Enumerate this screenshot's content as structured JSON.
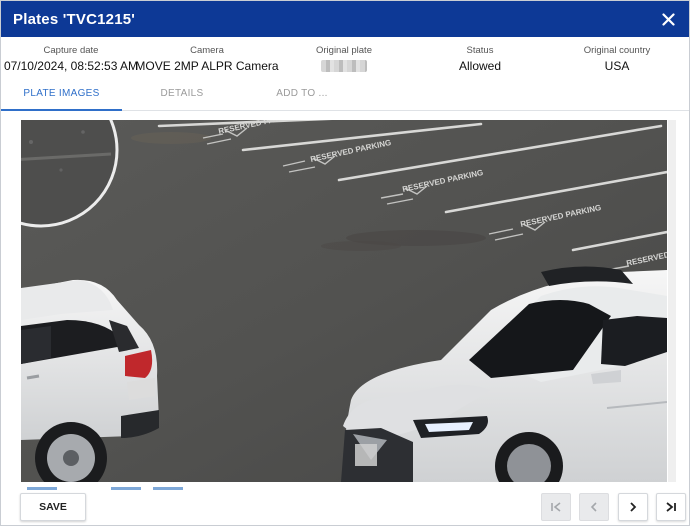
{
  "dialog": {
    "title": "Plates 'TVC1215'",
    "close_icon": "close-icon",
    "accent_color": "#0d3996"
  },
  "details": {
    "capture_date": {
      "label": "Capture date",
      "value": "07/10/2024, 08:52:53 AM"
    },
    "camera": {
      "label": "Camera",
      "value": "MOVE 2MP ALPR Camera"
    },
    "original_plate": {
      "label": "Original plate",
      "value": ""
    },
    "status": {
      "label": "Status",
      "value": "Allowed"
    },
    "original_country": {
      "label": "Original country",
      "value": "USA"
    }
  },
  "tabs": [
    {
      "label": "PLATE IMAGES",
      "active": true
    },
    {
      "label": "DETAILS",
      "active": false
    },
    {
      "label": "ADD TO ...",
      "active": false
    }
  ],
  "footer": {
    "save_label": "SAVE",
    "nav_icons": [
      "first-page-icon",
      "previous-icon",
      "next-icon",
      "last-page-icon"
    ]
  },
  "image": {
    "parking_markings": [
      "RESERVED PARKING",
      "RESERVED PARKING",
      "RESERVED PARKING",
      "RESERVED PARKING",
      "RESERVED PARKING"
    ]
  }
}
